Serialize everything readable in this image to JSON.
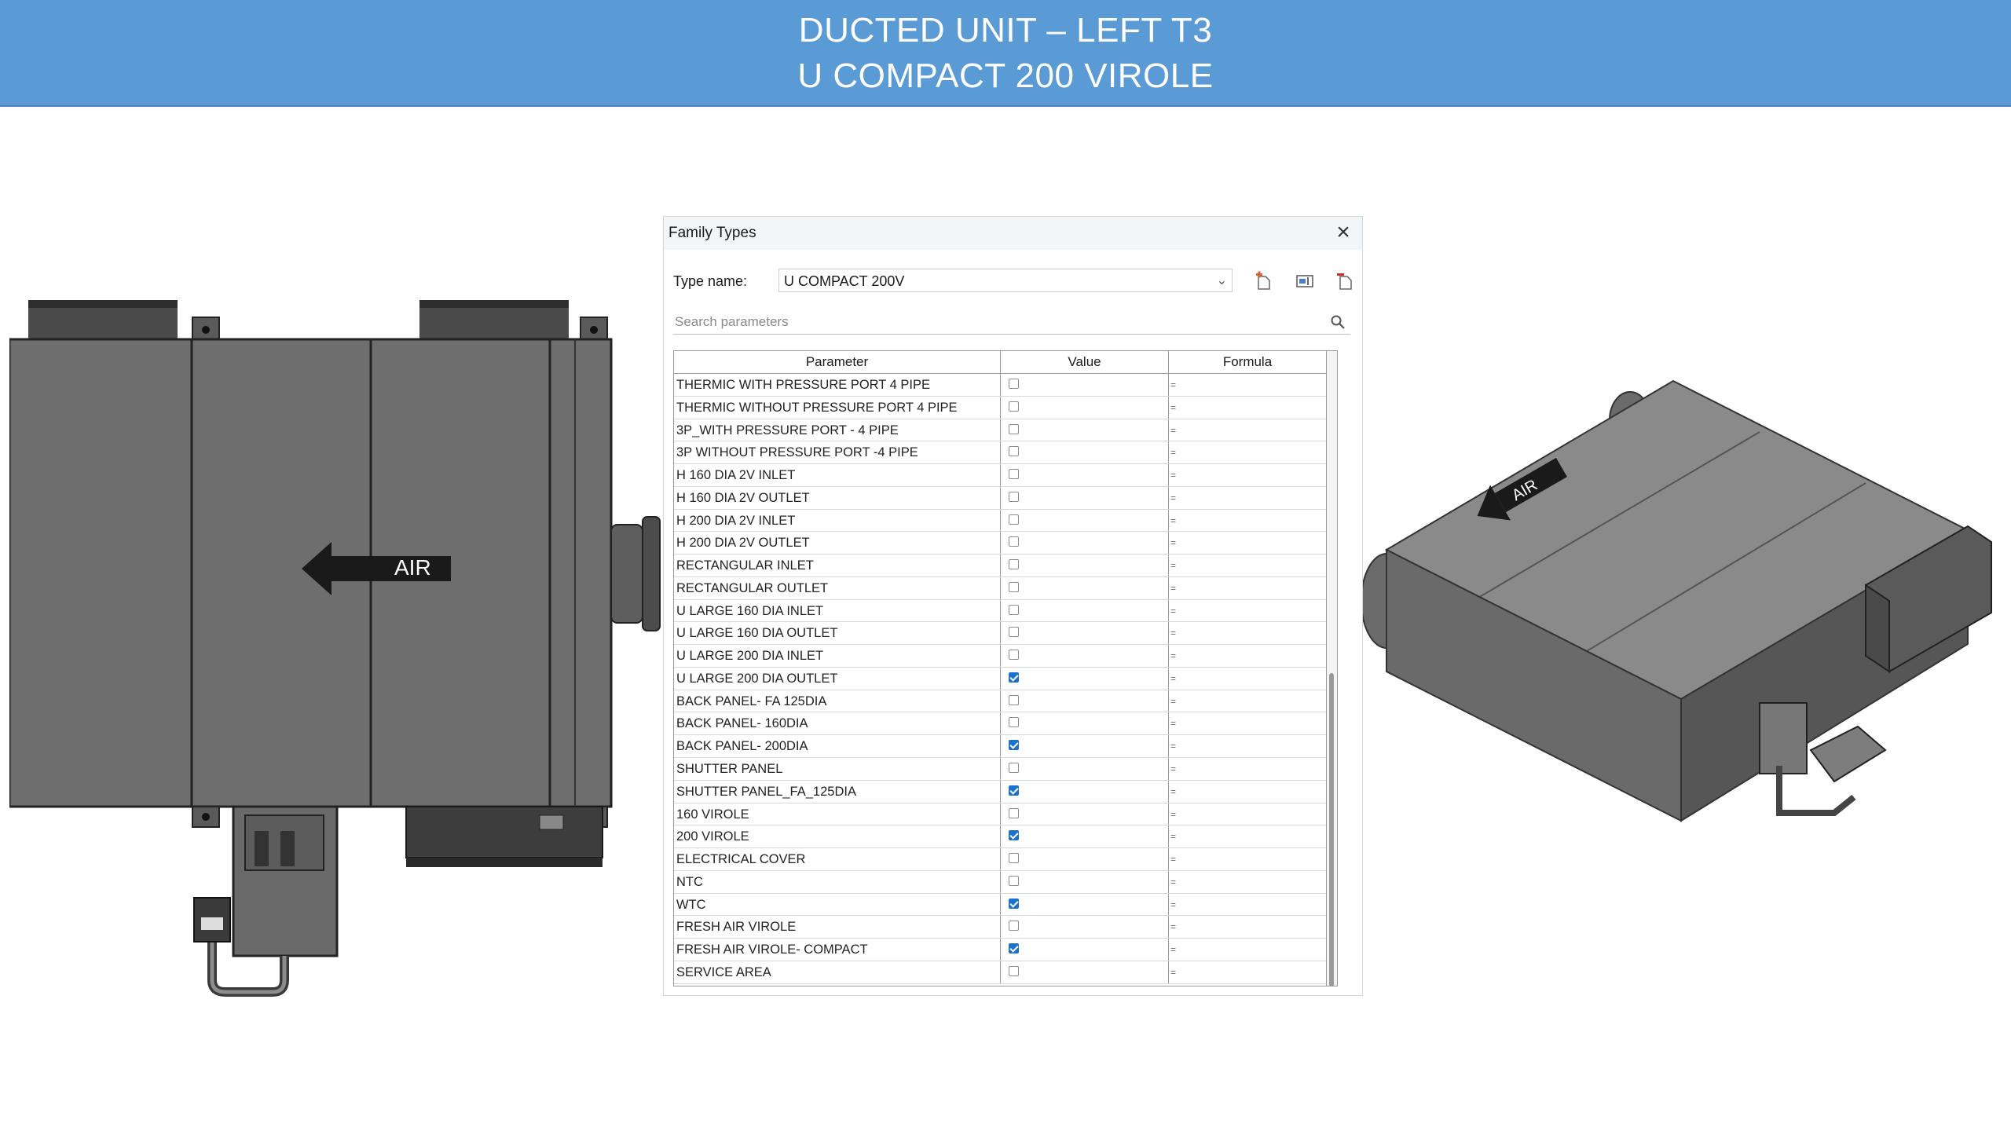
{
  "banner": {
    "line1": "DUCTED UNIT – LEFT T3",
    "line2": "U COMPACT 200 VIROLE"
  },
  "left_view": {
    "arrow_label": "AIR"
  },
  "right_view": {
    "arrow_label": "AIR"
  },
  "dialog": {
    "title": "Family Types",
    "type_name_label": "Type name:",
    "type_name_value": "U COMPACT 200V",
    "search_placeholder": "Search parameters",
    "columns": {
      "parameter": "Parameter",
      "value": "Value",
      "formula": "Formula"
    },
    "formula_marker": "=",
    "rows": [
      {
        "label": "THERMIC WITH PRESSURE PORT 4 PIPE",
        "checked": false
      },
      {
        "label": "THERMIC WITHOUT PRESSURE PORT  4 PIPE",
        "checked": false
      },
      {
        "label": "3P_WITH PRESSURE PORT - 4 PIPE",
        "checked": false
      },
      {
        "label": "3P WITHOUT PRESSURE PORT -4  PIPE",
        "checked": false
      },
      {
        "label": "H 160 DIA 2V INLET",
        "checked": false
      },
      {
        "label": "H 160 DIA 2V OUTLET",
        "checked": false
      },
      {
        "label": "H 200 DIA 2V INLET",
        "checked": false
      },
      {
        "label": "H 200 DIA 2V OUTLET",
        "checked": false
      },
      {
        "label": "RECTANGULAR INLET",
        "checked": false
      },
      {
        "label": "RECTANGULAR  OUTLET",
        "checked": false
      },
      {
        "label": "U LARGE 160 DIA INLET",
        "checked": false
      },
      {
        "label": "U LARGE 160 DIA OUTLET",
        "checked": false
      },
      {
        "label": "U LARGE 200 DIA INLET",
        "checked": false
      },
      {
        "label": "U LARGE 200 DIA OUTLET",
        "checked": true
      },
      {
        "label": "BACK PANEL- FA 125DIA",
        "checked": false
      },
      {
        "label": "BACK PANEL- 160DIA",
        "checked": false
      },
      {
        "label": "BACK PANEL- 200DIA",
        "checked": true
      },
      {
        "label": "SHUTTER PANEL",
        "checked": false
      },
      {
        "label": "SHUTTER PANEL_FA_125DIA",
        "checked": true
      },
      {
        "label": "160 VIROLE",
        "checked": false
      },
      {
        "label": "200 VIROLE",
        "checked": true
      },
      {
        "label": "ELECTRICAL COVER",
        "checked": false
      },
      {
        "label": "NTC",
        "checked": false
      },
      {
        "label": "WTC",
        "checked": true
      },
      {
        "label": "FRESH AIR VIROLE",
        "checked": false
      },
      {
        "label": "FRESH AIR VIROLE- COMPACT",
        "checked": true
      },
      {
        "label": "SERVICE AREA",
        "checked": false
      }
    ]
  },
  "colors": {
    "banner": "#5b9bd5",
    "checkbox_on": "#1a73c8",
    "unit_body": "#6e6e6e"
  },
  "icons": [
    "close-icon",
    "new-type-icon",
    "rename-type-icon",
    "delete-type-icon",
    "search-icon",
    "air-arrow-icon"
  ]
}
